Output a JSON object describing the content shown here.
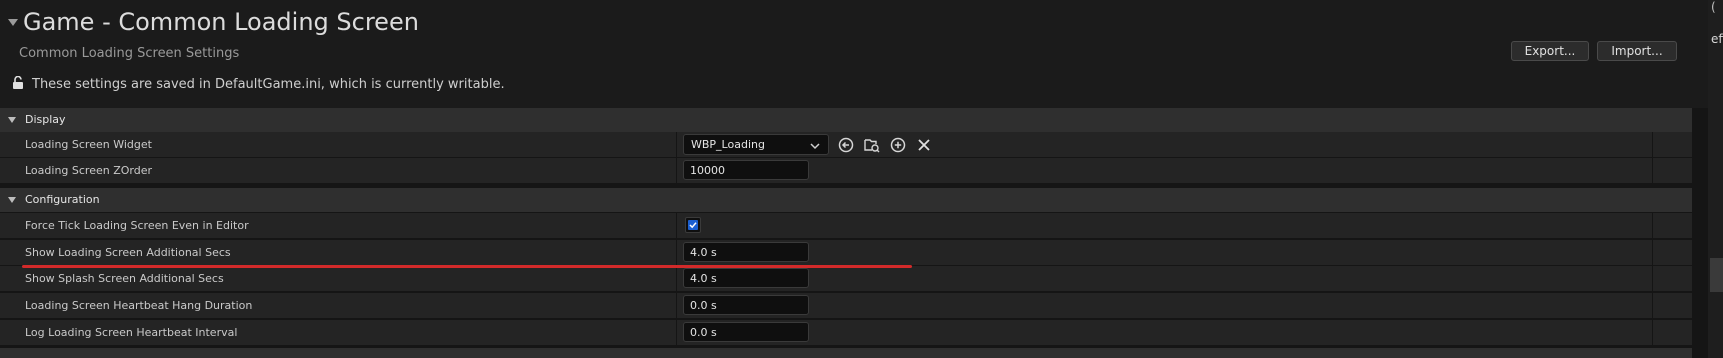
{
  "header": {
    "title": "Game - Common Loading Screen",
    "subtitle": "Common Loading Screen Settings",
    "notice": "These settings are saved in DefaultGame.ini, which is currently writable.",
    "export_label": "Export...",
    "import_label": "Import..."
  },
  "edge": {
    "partial_text": "efi",
    "bracket": "("
  },
  "sections": {
    "display": {
      "label": "Display",
      "rows": [
        {
          "label": "Loading Screen Widget",
          "value": "WBP_Loading"
        },
        {
          "label": "Loading Screen ZOrder",
          "value": "10000"
        }
      ]
    },
    "configuration": {
      "label": "Configuration",
      "rows": [
        {
          "label": "Force Tick Loading Screen Even in Editor",
          "checked": true
        },
        {
          "label": "Show Loading Screen Additional Secs",
          "value": "4.0 s"
        },
        {
          "label": "Show Splash Screen Additional Secs",
          "value": "4.0 s"
        },
        {
          "label": "Loading Screen Heartbeat Hang Duration",
          "value": "0.0 s"
        },
        {
          "label": "Log Loading Screen Heartbeat Interval",
          "value": "0.0 s"
        }
      ]
    }
  },
  "icons": {
    "lock": "unlock-icon",
    "use_selected": "use-selected-asset-icon",
    "browse": "browse-asset-icon",
    "add": "add-icon",
    "clear": "clear-icon",
    "dropdown": "chevron-down-icon",
    "checkmark": "checkmark-icon"
  },
  "colors": {
    "checkbox_fill": "#1b5fd1",
    "annotation_line": "#d22a2a"
  }
}
